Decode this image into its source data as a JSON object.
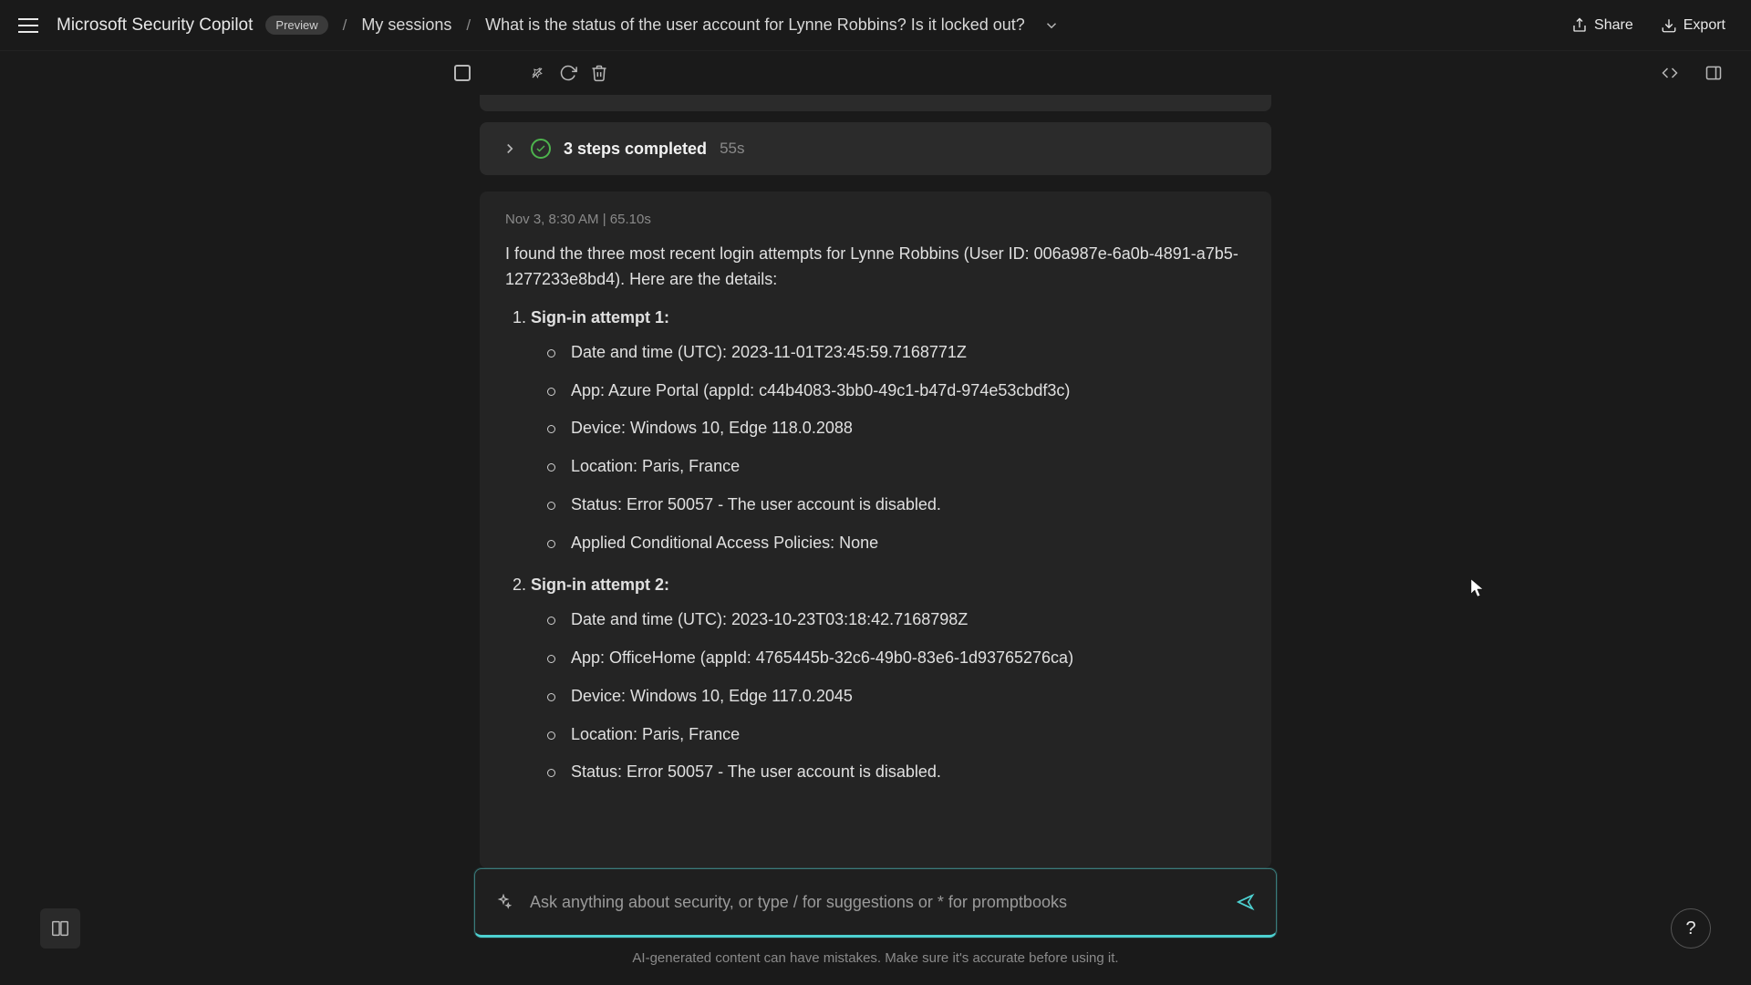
{
  "header": {
    "brand": "Microsoft Security Copilot",
    "preview_badge": "Preview",
    "crumb_sessions": "My sessions",
    "crumb_title": "What is the status of the user account for Lynne Robbins? Is it locked out?",
    "share_label": "Share",
    "export_label": "Export"
  },
  "steps": {
    "label": "3 steps completed",
    "duration": "55s"
  },
  "response": {
    "meta": "Nov 3, 8:30 AM  |  65.10s",
    "intro": "I found the three most recent login attempts for Lynne Robbins (User ID: 006a987e-6a0b-4891-a7b5-1277233e8bd4). Here are the details:",
    "attempts": [
      {
        "title": "Sign-in attempt 1:",
        "items": [
          "Date and time (UTC): 2023-11-01T23:45:59.7168771Z",
          "App: Azure Portal (appId: c44b4083-3bb0-49c1-b47d-974e53cbdf3c)",
          "Device: Windows 10, Edge 118.0.2088",
          "Location: Paris, France",
          "Status: Error 50057 - The user account is disabled.",
          "Applied Conditional Access Policies: None"
        ]
      },
      {
        "title": "Sign-in attempt 2:",
        "items": [
          "Date and time (UTC): 2023-10-23T03:18:42.7168798Z",
          "App: OfficeHome (appId: 4765445b-32c6-49b0-83e6-1d93765276ca)",
          "Device: Windows 10, Edge 117.0.2045",
          "Location: Paris, France",
          "Status: Error 50057 - The user account is disabled."
        ]
      }
    ]
  },
  "prompt": {
    "placeholder": "Ask anything about security, or type / for suggestions or * for promptbooks"
  },
  "disclaimer": "AI-generated content can have mistakes. Make sure it's accurate before using it.",
  "icons": {
    "help": "?"
  }
}
